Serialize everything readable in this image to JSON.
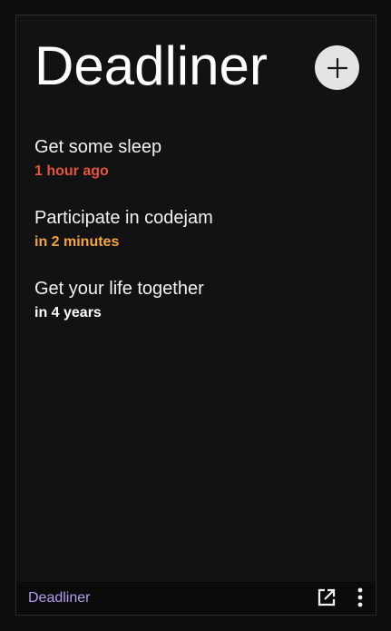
{
  "app": {
    "title": "Deadliner"
  },
  "icons": {
    "add": "plus-icon",
    "open": "external-link-icon",
    "more": "more-vertical-icon"
  },
  "colors": {
    "background": "#121212",
    "overdue": "#e5533d",
    "soon": "#f5a53b",
    "normal": "#ffffff",
    "accent": "#b49af0"
  },
  "deadlines": [
    {
      "title": "Get some sleep",
      "due": "1 hour ago",
      "status": "overdue"
    },
    {
      "title": "Participate in codejam",
      "due": "in 2 minutes",
      "status": "soon"
    },
    {
      "title": "Get your life together",
      "due": "in 4 years",
      "status": "normal"
    }
  ],
  "footer": {
    "label": "Deadliner"
  }
}
